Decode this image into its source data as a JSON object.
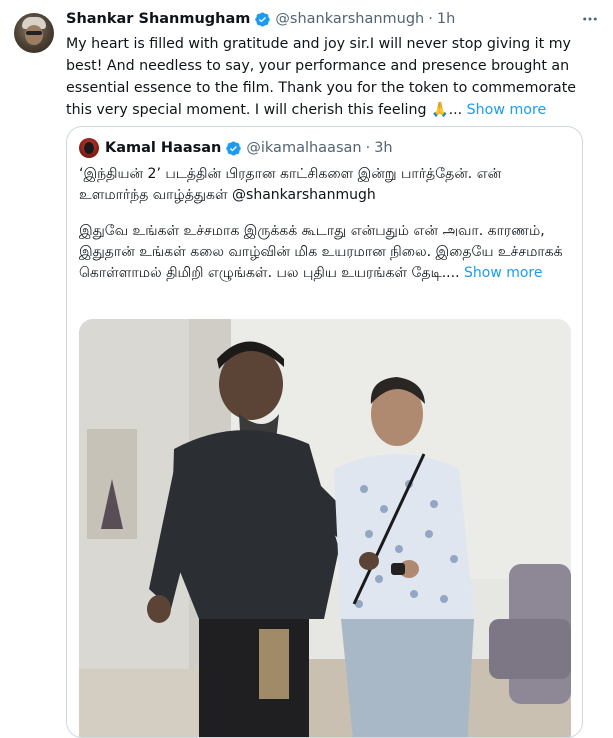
{
  "tweet": {
    "author_name": "Shankar Shanmugham",
    "handle": "@shankarshanmugh",
    "separator": "·",
    "time": "1h",
    "text": "My heart is filled with gratitude and joy sir.I will never stop giving it my best! And needless to say, your performance and presence brought an essential essence to the film. Thank you for the token to commemorate this very special moment. I will cherish this feeling 🙏...",
    "show_more": "Show more"
  },
  "quoted_tweet": {
    "author_name": "Kamal Haasan",
    "handle": "@ikamalhaasan",
    "separator": "·",
    "time": "3h",
    "paragraph_1": "‘இந்தியன் 2’ படத்தின் பிரதான காட்சிகளை இன்று பார்த்தேன். என் உளமார்ந்த வாழ்த்துகள் @shankarshanmugh",
    "paragraph_2": "இதுவே உங்கள் உச்சமாக இருக்கக் கூடாது என்பதும் என் அவா. காரணம், இதுதான் உங்கள் கலை வாழ்வின் மிக உயரமான நிலை. இதையே உச்சமாகக் கொள்ளாமல் திமிறி எழுங்கள். பல புதிய உயரங்கள் தேடி....",
    "show_more": "Show more"
  },
  "icons": {
    "verified": "verified-badge-icon",
    "more": "more-options-icon"
  },
  "colors": {
    "link": "#1d9bf0",
    "secondary_text": "#536471",
    "border": "#cfd9de",
    "verified": "#1d9bf0"
  }
}
